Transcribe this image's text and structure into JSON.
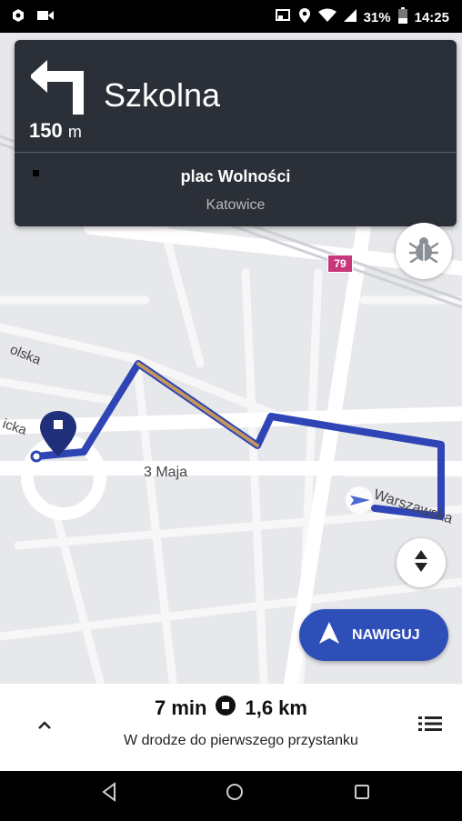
{
  "status_bar": {
    "battery": "31%",
    "time": "14:25",
    "icons": [
      "app-icon",
      "video-icon",
      "cast-icon",
      "location-icon",
      "wifi-icon",
      "signal-icon",
      "battery-icon"
    ]
  },
  "navigation": {
    "street": "Szkolna",
    "distance_value": "150",
    "distance_unit": "m",
    "destination_name": "plac Wolności",
    "destination_city": "Katowice"
  },
  "map": {
    "street_labels": [
      "olska",
      "icka",
      "3 Maja",
      "Warszawska"
    ],
    "road_badge": "79",
    "route_color": "#2f45b5",
    "traffic_color": "#c4975a"
  },
  "buttons": {
    "navigate_label": "NAWIGUJ"
  },
  "summary": {
    "duration": "7 min",
    "distance": "1,6 km",
    "subtitle": "W drodze do pierwszego przystanku"
  },
  "colors": {
    "card_bg": "#2b2f37",
    "accent": "#2f4fb8"
  }
}
